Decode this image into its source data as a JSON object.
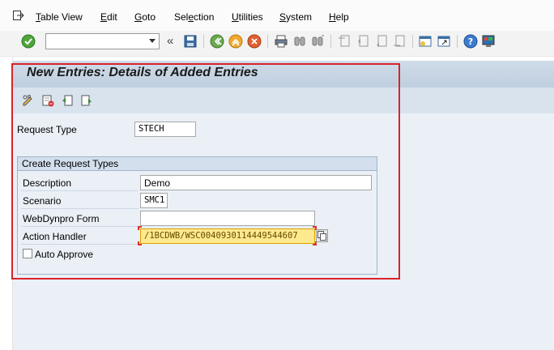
{
  "menu": {
    "items": [
      {
        "label": "Table View",
        "ul": "T",
        "rest": "able View"
      },
      {
        "label": "Edit",
        "ul": "E",
        "rest": "dit"
      },
      {
        "label": "Goto",
        "ul": "G",
        "rest": "oto"
      },
      {
        "label": "Selection",
        "pre": "Sel",
        "ul": "e",
        "rest": "ction"
      },
      {
        "label": "Utilities",
        "ul": "U",
        "rest": "tilities"
      },
      {
        "label": "System",
        "ul": "S",
        "rest": "ystem"
      },
      {
        "label": "Help",
        "ul": "H",
        "rest": "elp"
      }
    ]
  },
  "toolbar": {
    "command_value": "",
    "back_glyph": "«"
  },
  "page": {
    "title": "New Entries: Details of Added Entries"
  },
  "form": {
    "request_type_label": "Request Type",
    "request_type_value": "STECH",
    "group_title": "Create Request Types",
    "description_label": "Description",
    "description_value": "Demo",
    "scenario_label": "Scenario",
    "scenario_value": "SMC1",
    "webdynpro_label": "WebDynpro Form",
    "webdynpro_value": "",
    "action_handler_label": "Action Handler",
    "action_handler_value": "/1BCDWB/WSC0040930114449544607",
    "auto_approve_label": "Auto Approve",
    "auto_approve_checked": false
  },
  "colors": {
    "accent_red": "#d9242b",
    "highlight_yellow": "#fde98e"
  }
}
